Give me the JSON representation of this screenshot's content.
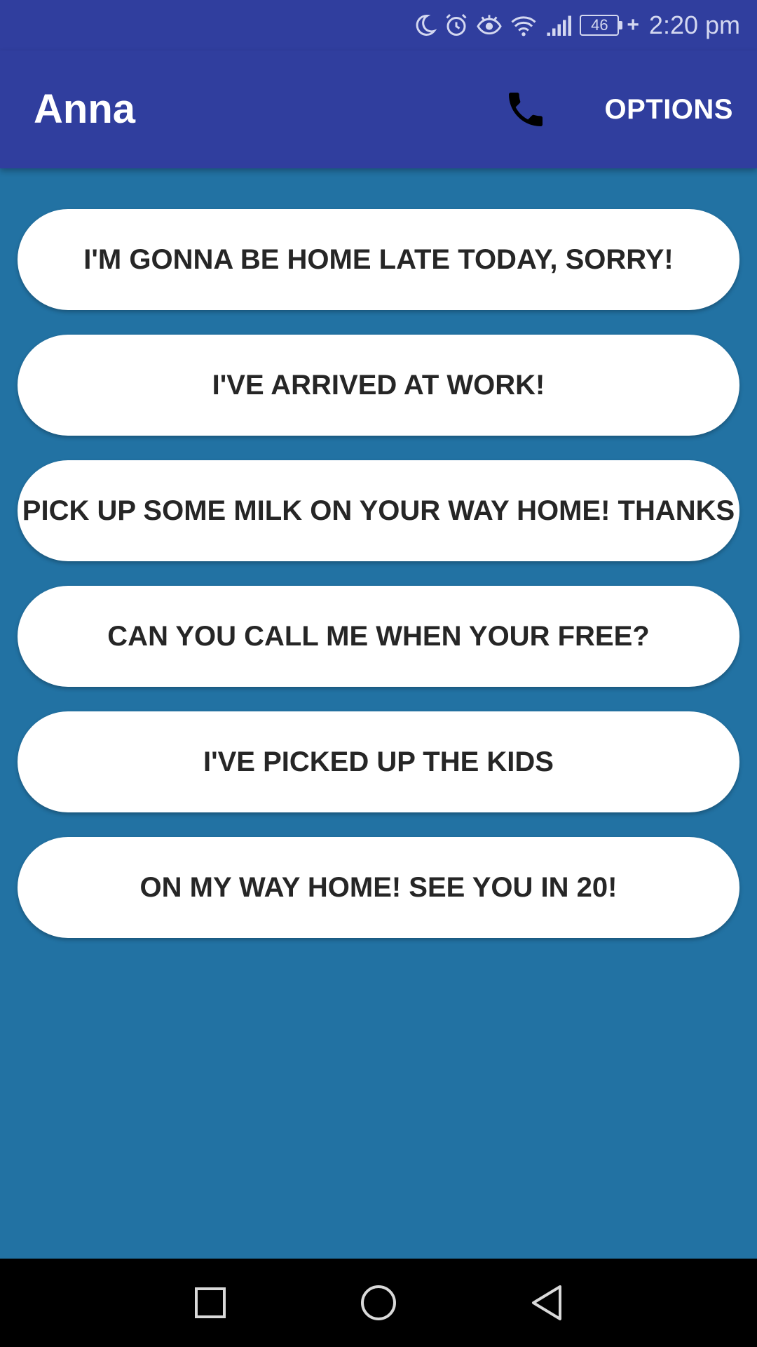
{
  "status_bar": {
    "battery_level": "46",
    "time": "2:20 pm",
    "icons": [
      "moon-icon",
      "alarm-icon",
      "eye-icon",
      "wifi-icon",
      "signal-icon",
      "battery-icon",
      "charging-plus-icon"
    ]
  },
  "app_bar": {
    "title": "Anna",
    "call_icon": "phone-icon",
    "options_label": "OPTIONS"
  },
  "messages": [
    {
      "label": "I'M GONNA BE HOME LATE TODAY, SORRY!"
    },
    {
      "label": "I'VE ARRIVED AT WORK!"
    },
    {
      "label": "PICK UP SOME MILK ON YOUR WAY HOME! THANKS"
    },
    {
      "label": "CAN YOU CALL ME WHEN YOUR FREE?"
    },
    {
      "label": "I'VE PICKED UP THE KIDS"
    },
    {
      "label": "ON MY WAY HOME! SEE YOU IN 20!"
    }
  ],
  "nav_bar": {
    "icons": [
      "recents-square-icon",
      "home-circle-icon",
      "back-triangle-icon"
    ]
  },
  "colors": {
    "app_bar": "#303e9e",
    "background": "#2272a3",
    "button": "#ffffff",
    "button_text": "#262626",
    "nav_bar": "#000000"
  }
}
